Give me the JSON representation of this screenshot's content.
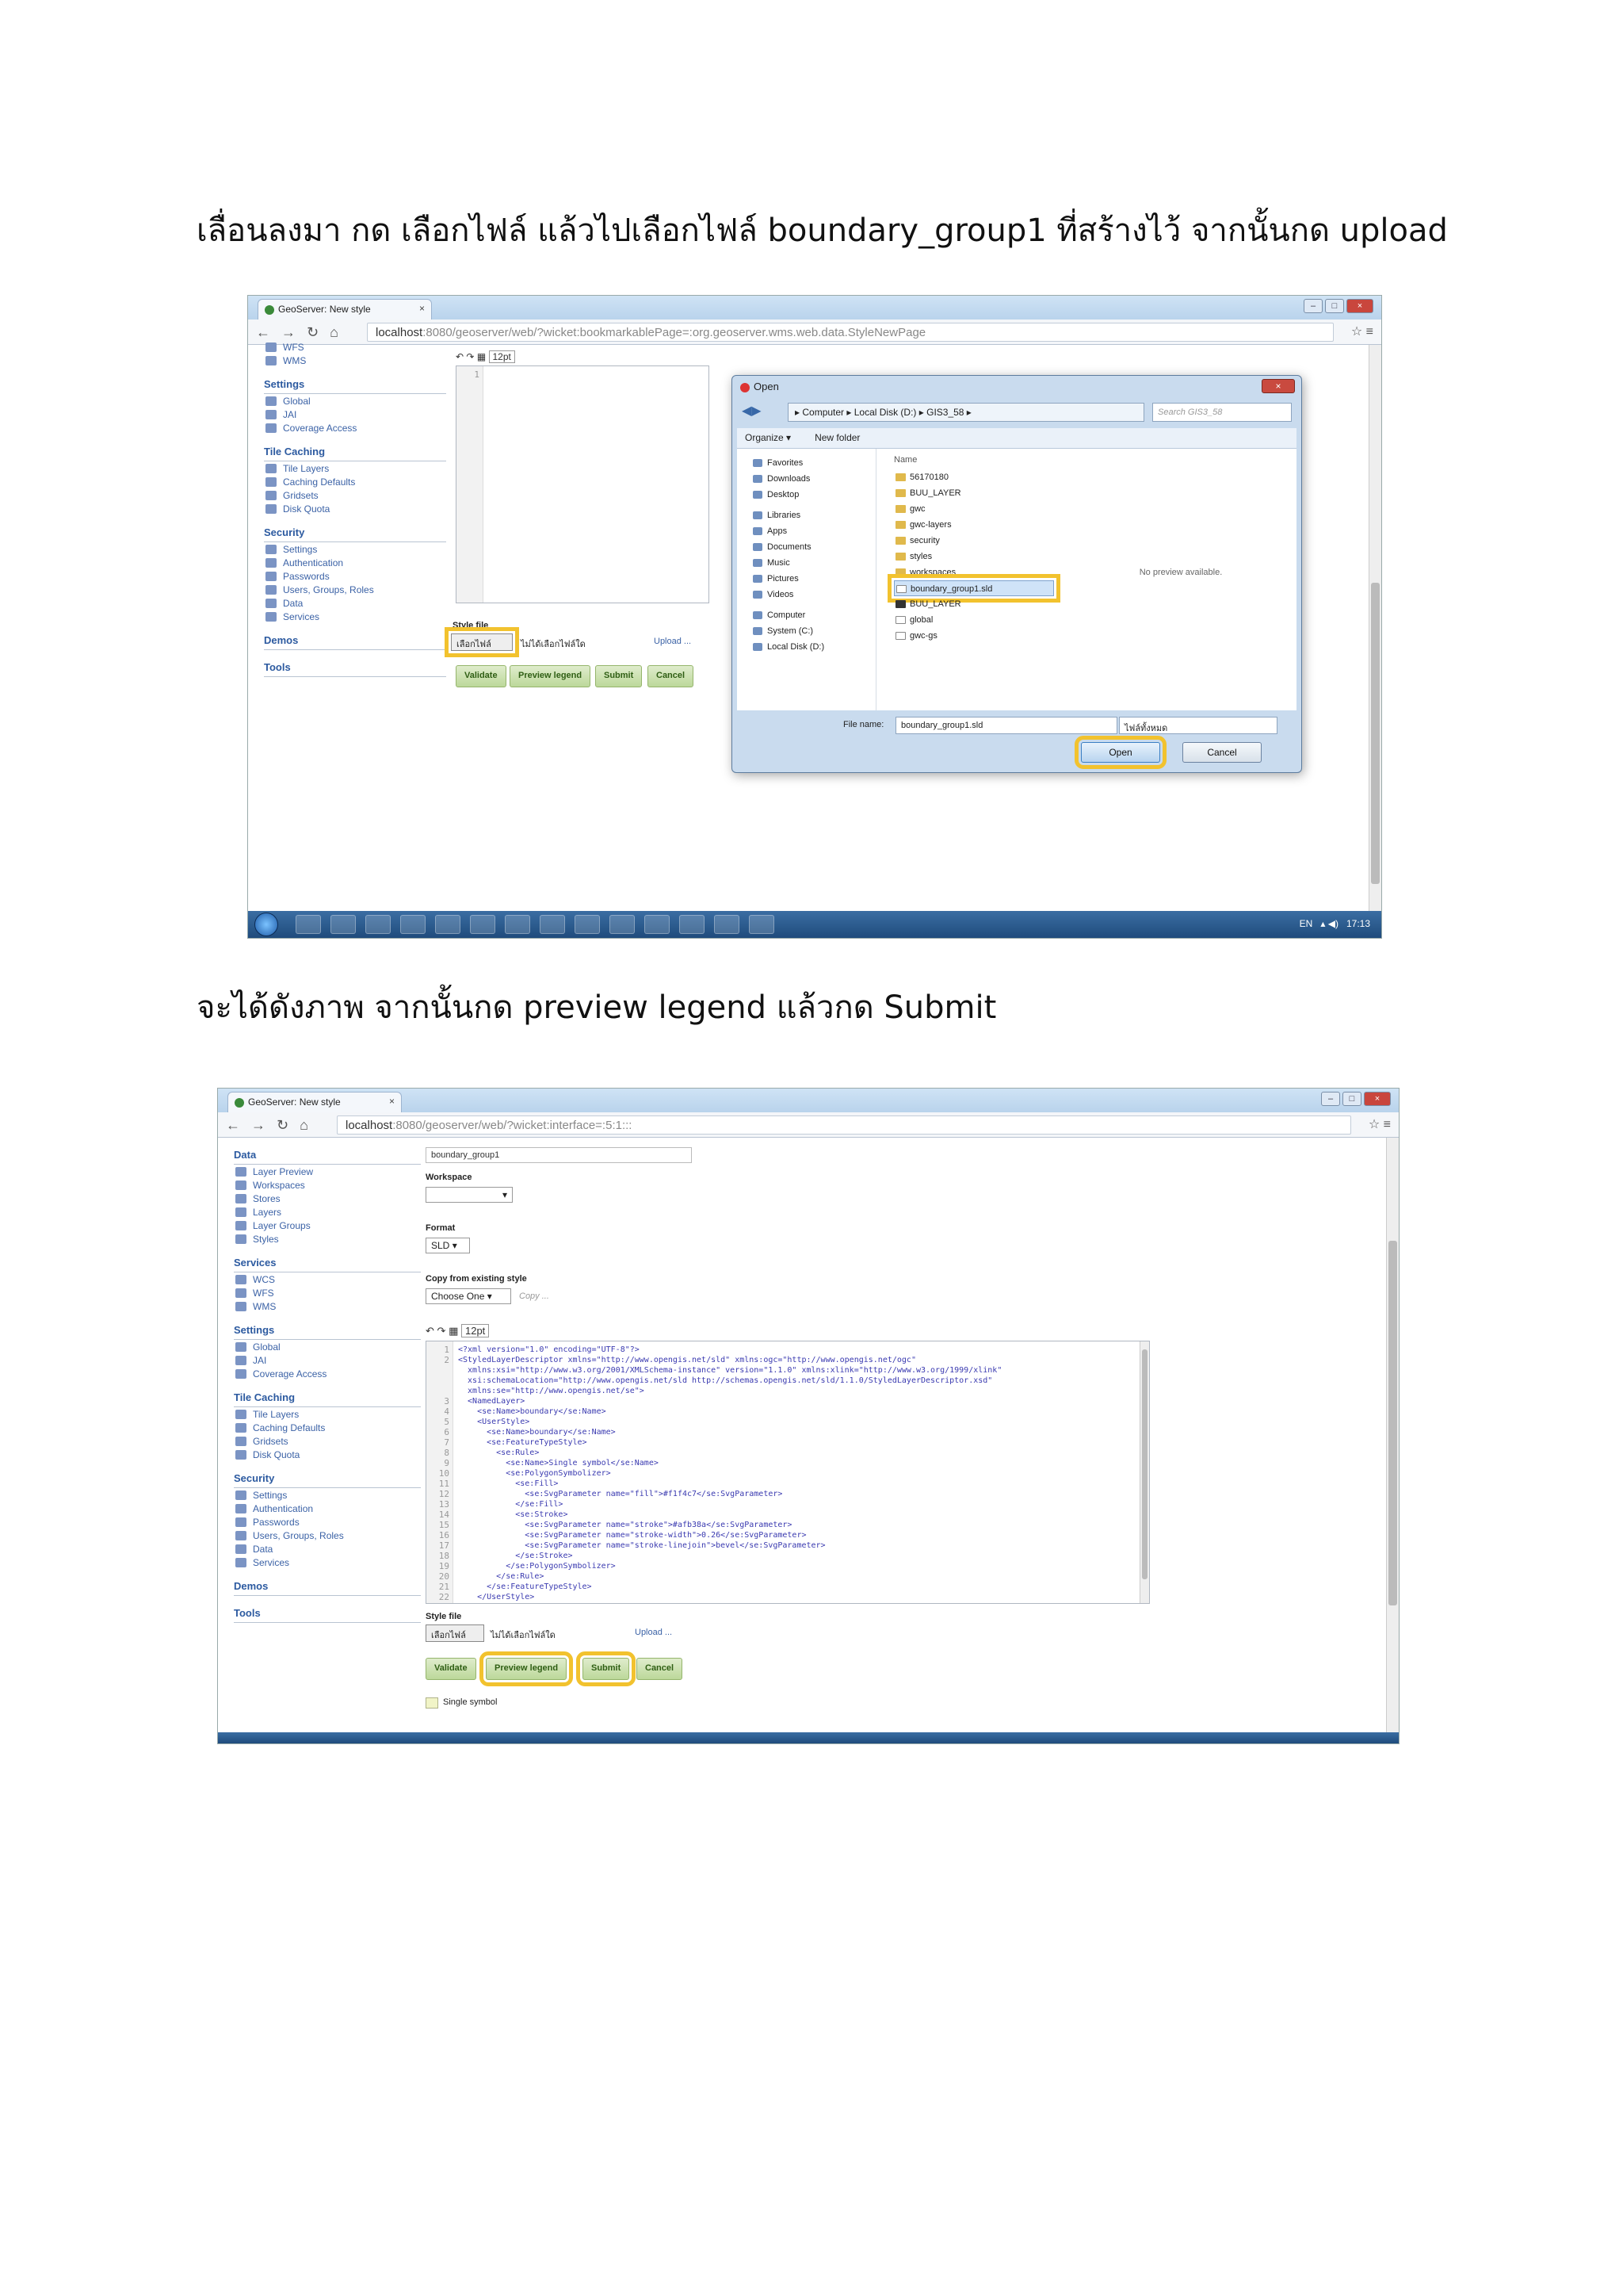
{
  "captions": {
    "step1": "เลื่อนลงมา กด เลือกไฟล์ แล้วไปเลือกไฟล์ boundary_group1 ที่สร้างไว้ จากนั้นกด upload",
    "step2": "จะได้ดังภาพ จากนั้นกด preview legend แล้วกด Submit"
  },
  "shot1": {
    "tab_title": "GeoServer: New style",
    "url_host": "localhost",
    "url_path": ":8080/geoserver/web/?wicket:bookmarkablePage=:org.geoserver.wms.web.data.StyleNewPage",
    "toolbar_font": "12pt",
    "sidebar": {
      "top_items": [
        "WFS",
        "WMS"
      ],
      "settings_head": "Settings",
      "settings": [
        "Global",
        "JAI",
        "Coverage Access"
      ],
      "tile_head": "Tile Caching",
      "tile": [
        "Tile Layers",
        "Caching Defaults",
        "Gridsets",
        "Disk Quota"
      ],
      "security_head": "Security",
      "security": [
        "Settings",
        "Authentication",
        "Passwords",
        "Users, Groups, Roles",
        "Data",
        "Services"
      ],
      "demos": "Demos",
      "tools": "Tools"
    },
    "style_file_label": "Style file",
    "choose_file_btn": "เลือกไฟล์",
    "no_file_text": "ไม่ได้เลือกไฟล์ใด",
    "upload_link": "Upload ...",
    "buttons": [
      "Validate",
      "Preview legend",
      "Submit",
      "Cancel"
    ],
    "dialog": {
      "title": "Open",
      "path": "▸ Computer ▸ Local Disk (D:) ▸ GIS3_58 ▸",
      "search_placeholder": "Search GIS3_58",
      "organize": "Organize ▾",
      "new_folder": "New folder",
      "nav": [
        "Favorites",
        "Downloads",
        "Desktop",
        "Libraries",
        "Apps",
        "Documents",
        "Music",
        "Pictures",
        "Videos",
        "Computer",
        "System (C:)",
        "Local Disk (D:)"
      ],
      "col_name": "Name",
      "files": [
        "56170180",
        "BUU_LAYER",
        "gwc",
        "gwc-layers",
        "security",
        "styles",
        "workspaces",
        "boundary_group1.sld",
        "BUU_LAYER",
        "global",
        "gwc-gs"
      ],
      "selected_file": "boundary_group1.sld",
      "no_preview": "No preview available.",
      "file_name_label": "File name:",
      "file_name_value": "boundary_group1.sld",
      "filter_value": "ไฟล์ทั้งหมด",
      "open_btn": "Open",
      "cancel_btn": "Cancel"
    },
    "taskbar_lang": "EN",
    "taskbar_time": "17:13"
  },
  "shot2": {
    "tab_title": "GeoServer: New style",
    "url_host": "localhost",
    "url_path": ":8080/geoserver/web/?wicket:interface=:5:1:::",
    "name_value": "boundary_group1",
    "workspace_label": "Workspace",
    "format_label": "Format",
    "format_value": "SLD",
    "copy_label": "Copy from existing style",
    "copy_select": "Choose One",
    "copy_link": "Copy ...",
    "toolbar_font": "12pt",
    "sidebar": {
      "data_head": "Data",
      "data": [
        "Layer Preview",
        "Workspaces",
        "Stores",
        "Layers",
        "Layer Groups",
        "Styles"
      ],
      "services_head": "Services",
      "services": [
        "WCS",
        "WFS",
        "WMS"
      ],
      "settings_head": "Settings",
      "settings": [
        "Global",
        "JAI",
        "Coverage Access"
      ],
      "tile_head": "Tile Caching",
      "tile": [
        "Tile Layers",
        "Caching Defaults",
        "Gridsets",
        "Disk Quota"
      ],
      "security_head": "Security",
      "security": [
        "Settings",
        "Authentication",
        "Passwords",
        "Users, Groups, Roles",
        "Data",
        "Services"
      ],
      "demos": "Demos",
      "tools": "Tools"
    },
    "code_lines": [
      "<?xml version=\"1.0\" encoding=\"UTF-8\"?>",
      "<StyledLayerDescriptor xmlns=\"http://www.opengis.net/sld\" xmlns:ogc=\"http://www.opengis.net/ogc\"",
      "  xmlns:xsi=\"http://www.w3.org/2001/XMLSchema-instance\" version=\"1.1.0\" xmlns:xlink=\"http://www.w3.org/1999/xlink\"",
      "  xsi:schemaLocation=\"http://www.opengis.net/sld http://schemas.opengis.net/sld/1.1.0/StyledLayerDescriptor.xsd\"",
      "  xmlns:se=\"http://www.opengis.net/se\">",
      "  <NamedLayer>",
      "    <se:Name>boundary</se:Name>",
      "    <UserStyle>",
      "      <se:Name>boundary</se:Name>",
      "      <se:FeatureTypeStyle>",
      "        <se:Rule>",
      "          <se:Name>Single symbol</se:Name>",
      "          <se:PolygonSymbolizer>",
      "            <se:Fill>",
      "              <se:SvgParameter name=\"fill\">#f1f4c7</se:SvgParameter>",
      "            </se:Fill>",
      "            <se:Stroke>",
      "              <se:SvgParameter name=\"stroke\">#afb38a</se:SvgParameter>",
      "              <se:SvgParameter name=\"stroke-width\">0.26</se:SvgParameter>",
      "              <se:SvgParameter name=\"stroke-linejoin\">bevel</se:SvgParameter>",
      "            </se:Stroke>",
      "          </se:PolygonSymbolizer>",
      "        </se:Rule>",
      "      </se:FeatureTypeStyle>",
      "    </UserStyle>"
    ],
    "gutter": "1\n2\n\n\n\n3\n4\n5\n6\n7\n8\n9\n10\n11\n12\n13\n14\n15\n16\n17\n18\n19\n20\n21\n22",
    "style_file_label": "Style file",
    "choose_file_btn": "เลือกไฟล์",
    "no_file_text": "ไม่ได้เลือกไฟล์ใด",
    "upload_link": "Upload ...",
    "buttons": [
      "Validate",
      "Preview legend",
      "Submit",
      "Cancel"
    ],
    "legend_label": "Single symbol"
  },
  "colors": {
    "highlight": "#f2c22e",
    "button_green": "#bcd89a",
    "link_blue": "#3b62a6"
  }
}
